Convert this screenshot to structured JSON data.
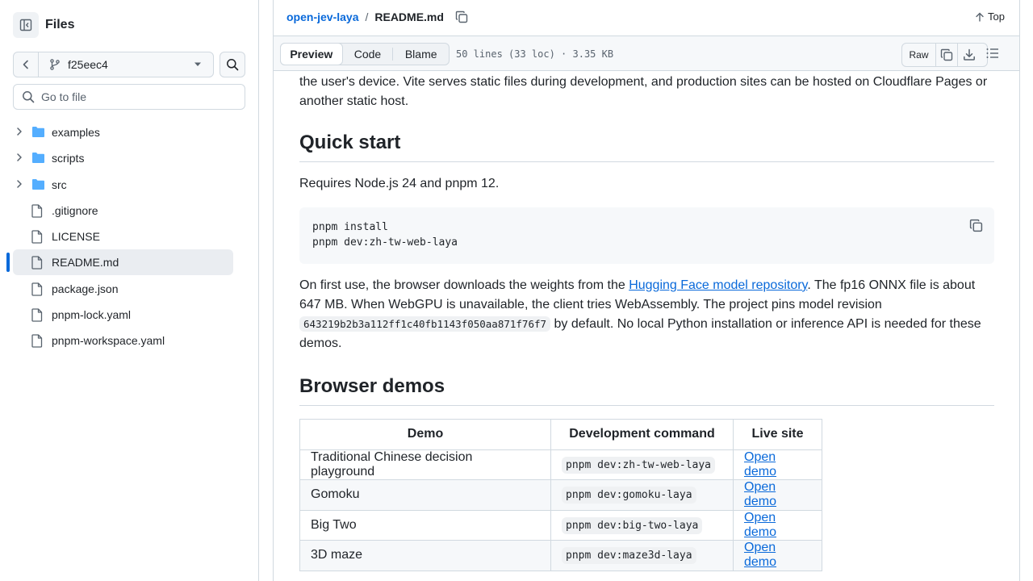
{
  "sidebar": {
    "title": "Files",
    "branch": "f25eec4",
    "goto_placeholder": "Go to file",
    "items": [
      {
        "label": "examples",
        "type": "folder"
      },
      {
        "label": "scripts",
        "type": "folder"
      },
      {
        "label": "src",
        "type": "folder"
      },
      {
        "label": ".gitignore",
        "type": "file"
      },
      {
        "label": "LICENSE",
        "type": "file"
      },
      {
        "label": "README.md",
        "type": "file",
        "active": true
      },
      {
        "label": "package.json",
        "type": "file"
      },
      {
        "label": "pnpm-lock.yaml",
        "type": "file"
      },
      {
        "label": "pnpm-workspace.yaml",
        "type": "file"
      }
    ]
  },
  "header": {
    "repo": "open-jev-laya",
    "separator": "/",
    "file": "README.md",
    "top_label": "Top"
  },
  "toolbar": {
    "preview": "Preview",
    "code": "Code",
    "blame": "Blame",
    "info": "50 lines (33 loc) · 3.35 KB",
    "raw": "Raw"
  },
  "readme": {
    "intro": "the user's device. Vite serves static files during development, and production sites can be hosted on Cloudflare Pages or another static host.",
    "quick_start_heading": "Quick start",
    "requires": "Requires Node.js 24 and pnpm 12.",
    "code_lines": [
      "pnpm install",
      "pnpm dev:zh-tw-web-laya"
    ],
    "first_use_1": "On first use, the browser downloads the weights from the ",
    "first_use_link": "Hugging Face model repository",
    "first_use_2": ". The fp16 ONNX file is about 647 MB. When WebGPU is unavailable, the client tries WebAssembly. The project pins model revision ",
    "revision": "643219b2b3a112ff1c40fb1143f050aa871f76f7",
    "first_use_3": " by default. No local Python installation or inference API is needed for these demos.",
    "demos_heading": "Browser demos",
    "table": {
      "headers": [
        "Demo",
        "Development command",
        "Live site"
      ],
      "rows": [
        {
          "demo": "Traditional Chinese decision playground",
          "command": "pnpm dev:zh-tw-web-laya",
          "link": "Open demo"
        },
        {
          "demo": "Gomoku",
          "command": "pnpm dev:gomoku-laya",
          "link": "Open demo"
        },
        {
          "demo": "Big Two",
          "command": "pnpm dev:big-two-laya",
          "link": "Open demo"
        },
        {
          "demo": "3D maze",
          "command": "pnpm dev:maze3d-laya",
          "link": "Open demo"
        }
      ]
    }
  },
  "colors": {
    "accent": "#0969da",
    "folder": "#54aeff",
    "border": "#d1d9e0",
    "muted": "#59636e"
  }
}
